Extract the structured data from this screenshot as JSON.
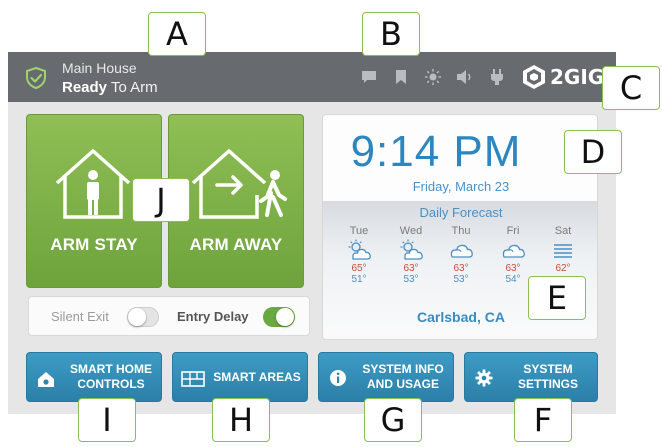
{
  "colors": {
    "header_bg": "#676a6e",
    "panel_bg": "#e6e6e6",
    "arm_green": "#7caf48",
    "action_blue": "#2f8bb6",
    "time_blue": "#2e86c1",
    "temp_high": "#cc4b3c",
    "temp_low": "#4a8fc4",
    "toggle_on": "#6aa93f",
    "callout_border": "#8cbf4d"
  },
  "header": {
    "location": "Main House",
    "status_bold": "Ready",
    "status_rest": "To Arm",
    "icons": [
      "shield-check-icon",
      "message-icon",
      "bookmark-icon",
      "brightness-icon",
      "volume-icon",
      "plug-icon",
      "2gig-logo-icon"
    ],
    "brand": "2GIG"
  },
  "arm": {
    "stay_label": "ARM STAY",
    "away_label": "ARM AWAY"
  },
  "toggles": {
    "silent_exit": {
      "label": "Silent Exit",
      "on": false
    },
    "entry_delay": {
      "label": "Entry Delay",
      "on": true
    }
  },
  "clock": {
    "time": "9:14 PM",
    "date": "Friday, March 23"
  },
  "forecast": {
    "title": "Daily Forecast",
    "days": [
      {
        "day": "Tue",
        "icon": "partly-sunny-icon",
        "high": "65°",
        "low": "51°"
      },
      {
        "day": "Wed",
        "icon": "partly-sunny-icon",
        "high": "63°",
        "low": "53°"
      },
      {
        "day": "Thu",
        "icon": "cloudy-icon",
        "high": "63°",
        "low": "53°"
      },
      {
        "day": "Fri",
        "icon": "cloudy-icon",
        "high": "63°",
        "low": "54°"
      },
      {
        "day": "Sat",
        "icon": "fog-icon",
        "high": "62°",
        "low": ""
      }
    ],
    "city": "Carlsbad, CA"
  },
  "buttons": {
    "smart_home": "SMART HOME CONTROLS",
    "smart_areas": "SMART AREAS",
    "system_info": "SYSTEM INFO AND USAGE",
    "system_settings": "SYSTEM SETTINGS"
  },
  "callouts": {
    "A": "A",
    "B": "B",
    "C": "C",
    "D": "D",
    "E": "E",
    "F": "F",
    "G": "G",
    "H": "H",
    "I": "I",
    "J": "J"
  }
}
